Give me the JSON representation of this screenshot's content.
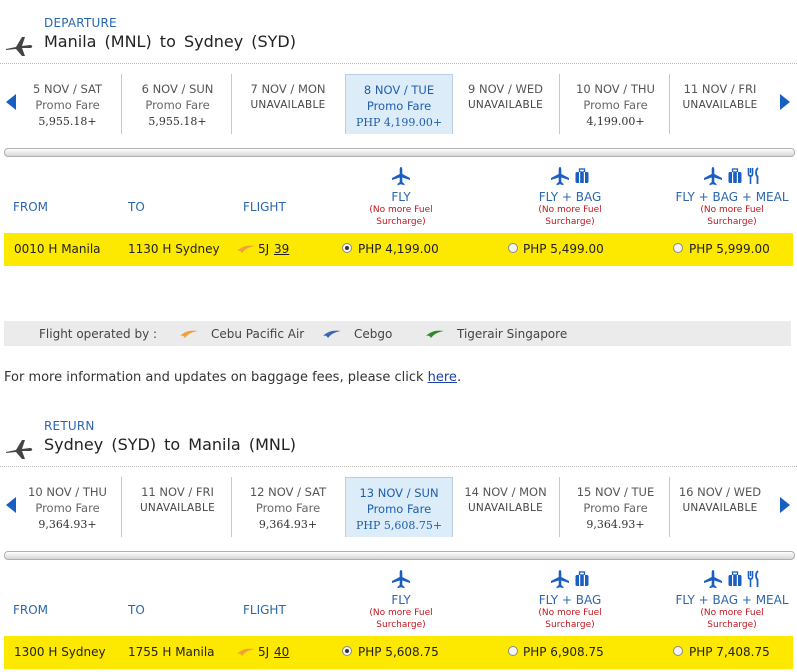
{
  "departure": {
    "label": "DEPARTURE",
    "route": "Manila  (MNL)  to  Sydney  (SYD)",
    "dates": [
      {
        "date": "5 NOV / SAT",
        "fare": "Promo Fare",
        "price": "5,955.18+"
      },
      {
        "date": "6 NOV / SUN",
        "fare": "Promo Fare",
        "price": "5,955.18+"
      },
      {
        "date": "7 NOV / MON",
        "fare": "UNAVAILABLE",
        "price": ""
      },
      {
        "date": "8 NOV / TUE",
        "fare": "Promo Fare",
        "price": "PHP 4,199.00+"
      },
      {
        "date": "9 NOV / WED",
        "fare": "UNAVAILABLE",
        "price": ""
      },
      {
        "date": "10 NOV / THU",
        "fare": "Promo Fare",
        "price": "4,199.00+"
      },
      {
        "date": "11 NOV / FRI",
        "fare": "UNAVAILABLE",
        "price": ""
      }
    ],
    "selected_date_index": 3,
    "headers": {
      "from": "FROM",
      "to": "TO",
      "flight": "FLIGHT"
    },
    "fares": [
      {
        "name": "FLY",
        "note1": "(No more Fuel",
        "note2": "Surcharge)",
        "icons": [
          "plane-icon"
        ]
      },
      {
        "name": "FLY + BAG",
        "note1": "(No more Fuel",
        "note2": "Surcharge)",
        "icons": [
          "plane-icon",
          "bag-icon"
        ]
      },
      {
        "name": "FLY + BAG + MEAL",
        "note1": "(No more Fuel",
        "note2": "Surcharge)",
        "icons": [
          "plane-icon",
          "bag-icon",
          "meal-icon"
        ]
      }
    ],
    "flight": {
      "from": "0010 H  Manila",
      "to": "1130 H  Sydney",
      "carrier": "5J",
      "number": "39",
      "prices": [
        "PHP 4,199.00",
        "PHP 5,499.00",
        "PHP 5,999.00"
      ],
      "selected_fare_index": 0
    }
  },
  "operated": {
    "label": "Flight operated by :",
    "carriers": [
      {
        "name": "Cebu Pacific Air",
        "color": "#f2a13a"
      },
      {
        "name": "Cebgo",
        "color": "#3c67b5"
      },
      {
        "name": "Tigerair Singapore",
        "color": "#2e8a2a"
      }
    ]
  },
  "info": {
    "text": "For more information and updates on baggage fees, please click ",
    "link": "here",
    "end": "."
  },
  "return": {
    "label": "RETURN",
    "route": "Sydney  (SYD)  to  Manila  (MNL)",
    "dates": [
      {
        "date": "10 NOV / THU",
        "fare": "Promo Fare",
        "price": "9,364.93+"
      },
      {
        "date": "11 NOV / FRI",
        "fare": "UNAVAILABLE",
        "price": ""
      },
      {
        "date": "12 NOV / SAT",
        "fare": "Promo Fare",
        "price": "9,364.93+"
      },
      {
        "date": "13 NOV / SUN",
        "fare": "Promo Fare",
        "price": "PHP 5,608.75+"
      },
      {
        "date": "14 NOV / MON",
        "fare": "UNAVAILABLE",
        "price": ""
      },
      {
        "date": "15 NOV / TUE",
        "fare": "Promo Fare",
        "price": "9,364.93+"
      },
      {
        "date": "16 NOV / WED",
        "fare": "UNAVAILABLE",
        "price": ""
      }
    ],
    "selected_date_index": 3,
    "headers": {
      "from": "FROM",
      "to": "TO",
      "flight": "FLIGHT"
    },
    "fares": [
      {
        "name": "FLY",
        "note1": "(No more Fuel",
        "note2": "Surcharge)",
        "icons": [
          "plane-icon"
        ]
      },
      {
        "name": "FLY + BAG",
        "note1": "(No more Fuel",
        "note2": "Surcharge)",
        "icons": [
          "plane-icon",
          "bag-icon"
        ]
      },
      {
        "name": "FLY + BAG + MEAL",
        "note1": "(No more Fuel",
        "note2": "Surcharge)",
        "icons": [
          "plane-icon",
          "bag-icon",
          "meal-icon"
        ]
      }
    ],
    "flight": {
      "from": "1300 H  Sydney",
      "to": "1755 H  Manila",
      "carrier": "5J",
      "number": "40",
      "prices": [
        "PHP 5,608.75",
        "PHP 6,908.75",
        "PHP 7,408.75"
      ],
      "selected_fare_index": 0
    }
  },
  "colors": {
    "accent": "#2a66b0",
    "highlight_row": "#fde900",
    "selected_date": "#dcecf8",
    "note": "#c0161e"
  }
}
